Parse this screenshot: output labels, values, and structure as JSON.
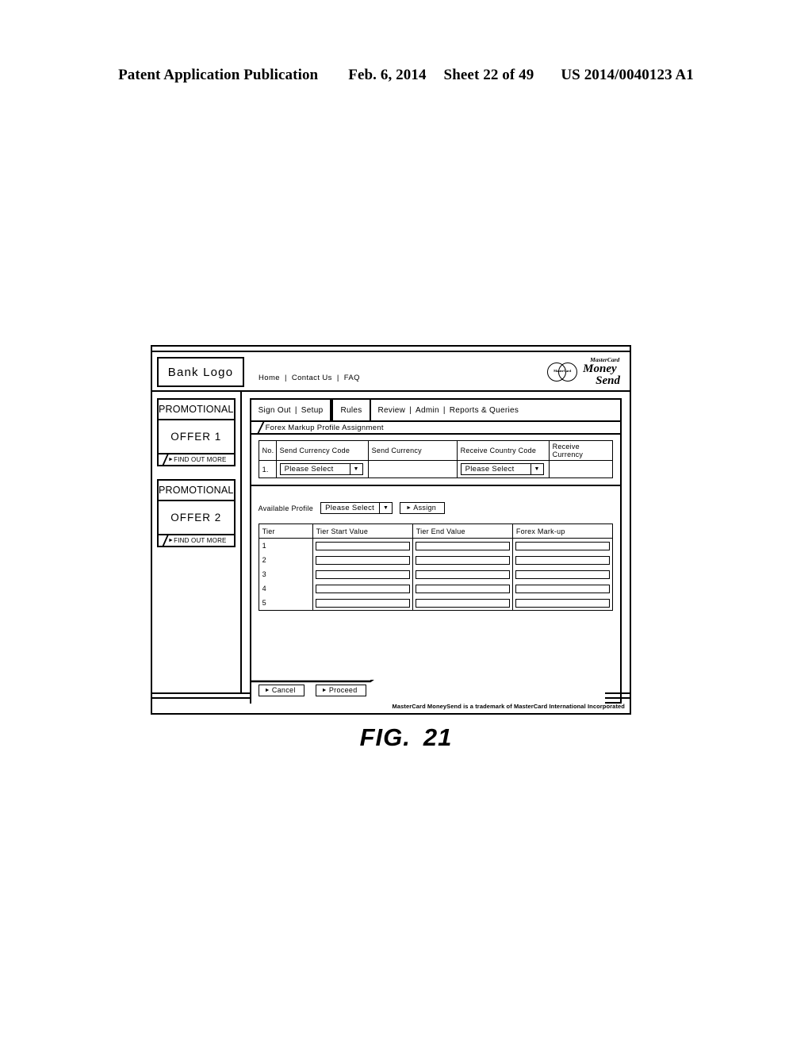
{
  "patent_header": {
    "publication": "Patent Application Publication",
    "date": "Feb. 6, 2014",
    "sheet": "Sheet 22 of 49",
    "number": "US 2014/0040123 A1"
  },
  "figure": {
    "label": "FIG.",
    "number": "21"
  },
  "mockup": {
    "bank_logo": "Bank Logo",
    "top_links": [
      "Home",
      "Contact Us",
      "FAQ"
    ],
    "link_separator": "|",
    "brand": {
      "circles_word": "MasterCard",
      "line1": "MasterCard",
      "line2": "Money",
      "line3": "Send"
    },
    "sidebar": {
      "panels": [
        {
          "title": "PROMOTIONAL",
          "offer": "OFFER 1",
          "cta": "FIND OUT MORE"
        },
        {
          "title": "PROMOTIONAL",
          "offer": "OFFER 2",
          "cta": "FIND OUT MORE"
        }
      ]
    },
    "tabs": {
      "group1": {
        "items": [
          "Sign Out",
          "Setup"
        ],
        "separator": "|"
      },
      "group2": {
        "label": "Rules",
        "active": true
      },
      "group3": {
        "items": [
          "Review",
          "Admin",
          "Reports & Queries"
        ],
        "separator": "|"
      }
    },
    "subtab": "Forex Markup Profile Assignment",
    "currency_table": {
      "headers": [
        "No.",
        "Send Currency Code",
        "Send Currency",
        "Receive Country Code",
        "Receive Currency"
      ],
      "rows": [
        {
          "no": "1.",
          "send_currency_code": "Please Select",
          "send_currency": "",
          "receive_country_code": "Please Select",
          "receive_currency": ""
        }
      ]
    },
    "profile_row": {
      "label": "Available Profile",
      "select_value": "Please Select",
      "assign_button": "Assign"
    },
    "tier_table": {
      "headers": [
        "Tier",
        "Tier Start Value",
        "Tier End Value",
        "Forex Mark-up"
      ],
      "rows": [
        {
          "tier": "1",
          "start": "",
          "end": "",
          "markup": ""
        },
        {
          "tier": "2",
          "start": "",
          "end": "",
          "markup": ""
        },
        {
          "tier": "3",
          "start": "",
          "end": "",
          "markup": ""
        },
        {
          "tier": "4",
          "start": "",
          "end": "",
          "markup": ""
        },
        {
          "tier": "5",
          "start": "",
          "end": "",
          "markup": ""
        }
      ]
    },
    "actions": {
      "cancel": "Cancel",
      "proceed": "Proceed"
    },
    "footer_text": "MasterCard MoneySend is a trademark of MasterCard International Incorporated"
  }
}
